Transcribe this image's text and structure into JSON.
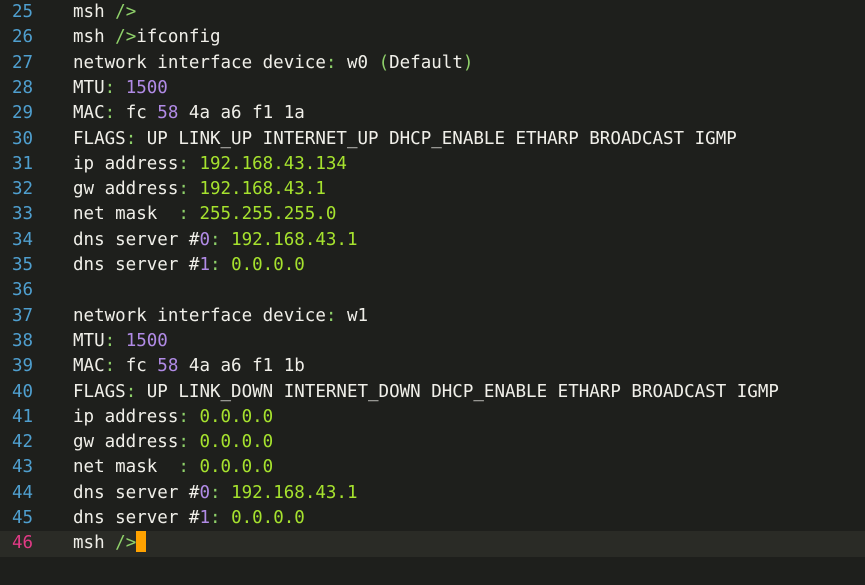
{
  "colors": {
    "background": "#1e1f1c",
    "line_number": "#4f9fcf",
    "line_number_active": "#e03a85",
    "text": "#f0efe9",
    "punctuation": "#8fd16a",
    "value": "#a6e22e",
    "number": "#b18be6",
    "cursor": "#ffa200",
    "current_line": "#2a2b26"
  },
  "cursor_line": 46,
  "lines": [
    {
      "n": "25",
      "segs": [
        {
          "t": "msh ",
          "c": "text"
        },
        {
          "t": "/>",
          "c": "punct"
        }
      ]
    },
    {
      "n": "26",
      "segs": [
        {
          "t": "msh ",
          "c": "text"
        },
        {
          "t": "/>",
          "c": "punct"
        },
        {
          "t": "ifconfig",
          "c": "text"
        }
      ]
    },
    {
      "n": "27",
      "segs": [
        {
          "t": "network interface device",
          "c": "text"
        },
        {
          "t": ": ",
          "c": "punct"
        },
        {
          "t": "w0 ",
          "c": "text"
        },
        {
          "t": "(",
          "c": "punct"
        },
        {
          "t": "Default",
          "c": "text"
        },
        {
          "t": ")",
          "c": "punct"
        }
      ]
    },
    {
      "n": "28",
      "segs": [
        {
          "t": "MTU",
          "c": "text"
        },
        {
          "t": ": ",
          "c": "punct"
        },
        {
          "t": "1500",
          "c": "num"
        }
      ]
    },
    {
      "n": "29",
      "segs": [
        {
          "t": "MAC",
          "c": "text"
        },
        {
          "t": ": ",
          "c": "punct"
        },
        {
          "t": "fc ",
          "c": "text"
        },
        {
          "t": "58",
          "c": "num"
        },
        {
          "t": " 4a a6 f1 1a",
          "c": "text"
        }
      ]
    },
    {
      "n": "30",
      "segs": [
        {
          "t": "FLAGS",
          "c": "text"
        },
        {
          "t": ": ",
          "c": "punct"
        },
        {
          "t": "UP LINK_UP INTERNET_UP DHCP_ENABLE ETHARP BROADCAST IGMP",
          "c": "text"
        }
      ]
    },
    {
      "n": "31",
      "segs": [
        {
          "t": "ip address",
          "c": "text"
        },
        {
          "t": ": ",
          "c": "punct"
        },
        {
          "t": "192.168.43.134",
          "c": "val"
        }
      ]
    },
    {
      "n": "32",
      "segs": [
        {
          "t": "gw address",
          "c": "text"
        },
        {
          "t": ": ",
          "c": "punct"
        },
        {
          "t": "192.168.43.1",
          "c": "val"
        }
      ]
    },
    {
      "n": "33",
      "segs": [
        {
          "t": "net mask  ",
          "c": "text"
        },
        {
          "t": ": ",
          "c": "punct"
        },
        {
          "t": "255.255.255.0",
          "c": "val"
        }
      ]
    },
    {
      "n": "34",
      "segs": [
        {
          "t": "dns server #",
          "c": "text"
        },
        {
          "t": "0",
          "c": "num"
        },
        {
          "t": ": ",
          "c": "punct"
        },
        {
          "t": "192.168.43.1",
          "c": "val"
        }
      ]
    },
    {
      "n": "35",
      "segs": [
        {
          "t": "dns server #",
          "c": "text"
        },
        {
          "t": "1",
          "c": "num"
        },
        {
          "t": ": ",
          "c": "punct"
        },
        {
          "t": "0.0.0.0",
          "c": "val"
        }
      ]
    },
    {
      "n": "36",
      "segs": []
    },
    {
      "n": "37",
      "segs": [
        {
          "t": "network interface device",
          "c": "text"
        },
        {
          "t": ": ",
          "c": "punct"
        },
        {
          "t": "w1",
          "c": "text"
        }
      ]
    },
    {
      "n": "38",
      "segs": [
        {
          "t": "MTU",
          "c": "text"
        },
        {
          "t": ": ",
          "c": "punct"
        },
        {
          "t": "1500",
          "c": "num"
        }
      ]
    },
    {
      "n": "39",
      "segs": [
        {
          "t": "MAC",
          "c": "text"
        },
        {
          "t": ": ",
          "c": "punct"
        },
        {
          "t": "fc ",
          "c": "text"
        },
        {
          "t": "58",
          "c": "num"
        },
        {
          "t": " 4a a6 f1 1b",
          "c": "text"
        }
      ]
    },
    {
      "n": "40",
      "segs": [
        {
          "t": "FLAGS",
          "c": "text"
        },
        {
          "t": ": ",
          "c": "punct"
        },
        {
          "t": "UP LINK_DOWN INTERNET_DOWN DHCP_ENABLE ETHARP BROADCAST IGMP",
          "c": "text"
        }
      ]
    },
    {
      "n": "41",
      "segs": [
        {
          "t": "ip address",
          "c": "text"
        },
        {
          "t": ": ",
          "c": "punct"
        },
        {
          "t": "0.0.0.0",
          "c": "val"
        }
      ]
    },
    {
      "n": "42",
      "segs": [
        {
          "t": "gw address",
          "c": "text"
        },
        {
          "t": ": ",
          "c": "punct"
        },
        {
          "t": "0.0.0.0",
          "c": "val"
        }
      ]
    },
    {
      "n": "43",
      "segs": [
        {
          "t": "net mask  ",
          "c": "text"
        },
        {
          "t": ": ",
          "c": "punct"
        },
        {
          "t": "0.0.0.0",
          "c": "val"
        }
      ]
    },
    {
      "n": "44",
      "segs": [
        {
          "t": "dns server #",
          "c": "text"
        },
        {
          "t": "0",
          "c": "num"
        },
        {
          "t": ": ",
          "c": "punct"
        },
        {
          "t": "192.168.43.1",
          "c": "val"
        }
      ]
    },
    {
      "n": "45",
      "segs": [
        {
          "t": "dns server #",
          "c": "text"
        },
        {
          "t": "1",
          "c": "num"
        },
        {
          "t": ": ",
          "c": "punct"
        },
        {
          "t": "0.0.0.0",
          "c": "val"
        }
      ]
    },
    {
      "n": "46",
      "segs": [
        {
          "t": "msh ",
          "c": "text"
        },
        {
          "t": "/>",
          "c": "punct"
        }
      ]
    }
  ]
}
